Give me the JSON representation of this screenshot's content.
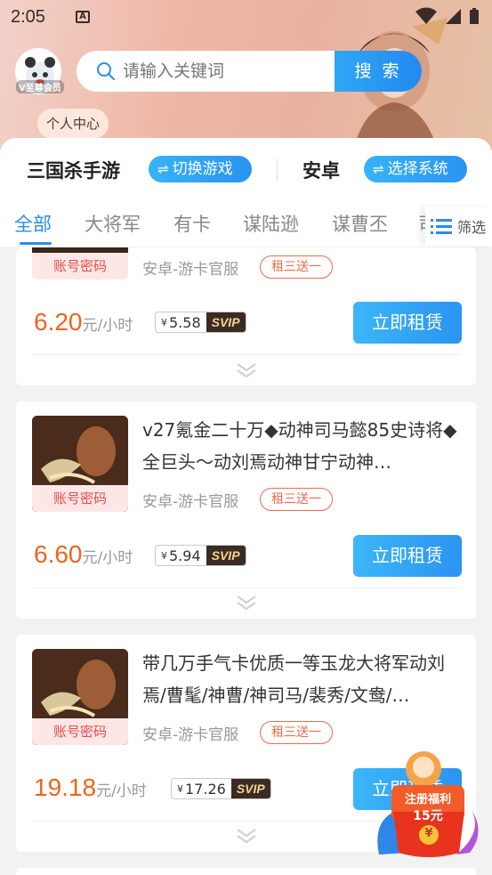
{
  "status_bar": {
    "time": "2:05",
    "notif_icon": "A"
  },
  "header": {
    "vip_label": "V至尊会员",
    "personal_center": "个人中心",
    "search": {
      "placeholder": "请输入关键词",
      "button": "搜 索"
    }
  },
  "selector": {
    "game": "三国杀手游",
    "switch_game": "切换游戏",
    "system": "安卓",
    "select_system": "选择系统"
  },
  "tabs": [
    "全部",
    "大将军",
    "有卡",
    "谋陆逊",
    "谋曹丕",
    "司"
  ],
  "filter_label": "筛选",
  "listings": [
    {
      "title": "",
      "badge": "账号密码",
      "platform": "安卓-游卡官服",
      "promo": "租三送一",
      "price": "6.20",
      "price_unit": "元/小时",
      "svip_price": "5.58",
      "svip_tag": "SVIP",
      "rent_button": "立即租赁"
    },
    {
      "title": "v27氪金二十万◆动神司马懿85史诗将◆全巨头～动刘焉动神甘宁动神…",
      "badge": "账号密码",
      "platform": "安卓-游卡官服",
      "promo": "租三送一",
      "price": "6.60",
      "price_unit": "元/小时",
      "svip_price": "5.94",
      "svip_tag": "SVIP",
      "rent_button": "立即租赁"
    },
    {
      "title": "带几万手气卡优质一等玉龙大将军动刘焉/曹髦/神曹/神司马/裴秀/文鸯/…",
      "badge": "账号密码",
      "platform": "安卓-游卡官服",
      "promo": "租三送一",
      "price": "19.18",
      "price_unit": "元/小时",
      "svip_price": "17.26",
      "svip_tag": "SVIP",
      "rent_button": "立即租赁"
    }
  ],
  "floating_promo": {
    "line1": "注册福利",
    "line2": "15元",
    "coin": "¥"
  },
  "colors": {
    "accent": "#2a8de8",
    "price": "#f0641e",
    "badge": "#e74c4c"
  }
}
